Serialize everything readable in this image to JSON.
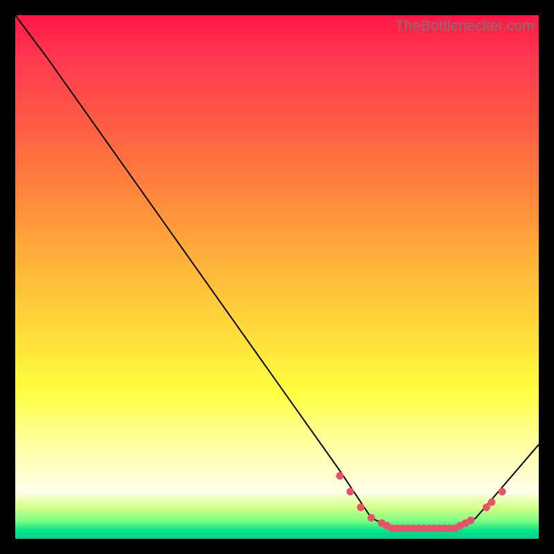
{
  "watermark": "TheBottlenecker.com",
  "chart_data": {
    "type": "line",
    "title": "",
    "xlabel": "",
    "ylabel": "",
    "xlim": [
      0,
      100
    ],
    "ylim": [
      0,
      100
    ],
    "curve": [
      {
        "x": 0,
        "y": 100
      },
      {
        "x": 6,
        "y": 92
      },
      {
        "x": 62,
        "y": 13
      },
      {
        "x": 68,
        "y": 4
      },
      {
        "x": 72,
        "y": 2
      },
      {
        "x": 78,
        "y": 2
      },
      {
        "x": 85,
        "y": 2
      },
      {
        "x": 88,
        "y": 4
      },
      {
        "x": 100,
        "y": 18
      }
    ],
    "markers": [
      {
        "x": 62,
        "y": 12
      },
      {
        "x": 64,
        "y": 9
      },
      {
        "x": 66,
        "y": 6
      },
      {
        "x": 68,
        "y": 4
      },
      {
        "x": 70,
        "y": 3
      },
      {
        "x": 71,
        "y": 2.5
      },
      {
        "x": 72,
        "y": 2
      },
      {
        "x": 73,
        "y": 2
      },
      {
        "x": 74,
        "y": 2
      },
      {
        "x": 75,
        "y": 2
      },
      {
        "x": 76,
        "y": 2
      },
      {
        "x": 77,
        "y": 2
      },
      {
        "x": 78,
        "y": 2
      },
      {
        "x": 79,
        "y": 2
      },
      {
        "x": 80,
        "y": 2
      },
      {
        "x": 81,
        "y": 2
      },
      {
        "x": 82,
        "y": 2
      },
      {
        "x": 83,
        "y": 2
      },
      {
        "x": 84,
        "y": 2
      },
      {
        "x": 85,
        "y": 2.5
      },
      {
        "x": 86,
        "y": 3
      },
      {
        "x": 87,
        "y": 3.5
      },
      {
        "x": 90,
        "y": 6
      },
      {
        "x": 91,
        "y": 7
      },
      {
        "x": 93,
        "y": 9
      }
    ],
    "marker_color": "#e9526a",
    "line_color": "#000000"
  }
}
